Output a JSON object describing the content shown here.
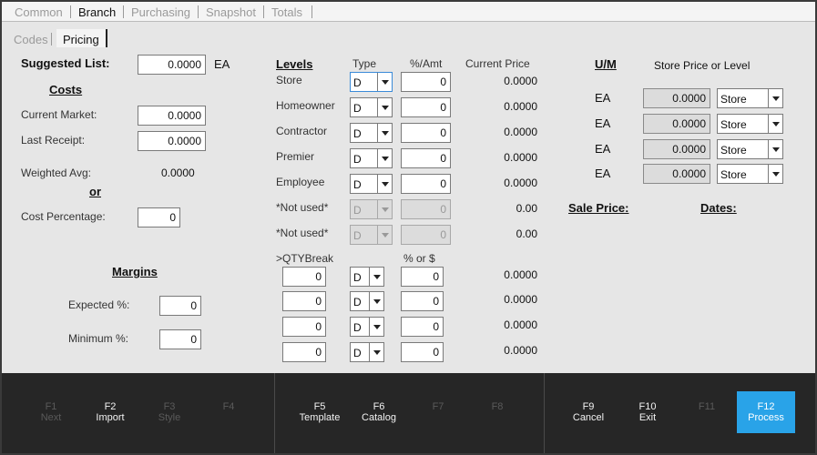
{
  "tabs": [
    "Common",
    "Branch",
    "Purchasing",
    "Snapshot",
    "Totals"
  ],
  "subtabs": [
    "Codes",
    "Pricing"
  ],
  "left": {
    "suggested_list_label": "Suggested List:",
    "suggested_list_value": "0.0000",
    "suggested_list_unit": "EA",
    "costs_label": "Costs",
    "current_market_label": "Current Market:",
    "current_market_value": "0.0000",
    "last_receipt_label": "Last Receipt:",
    "last_receipt_value": "0.0000",
    "weighted_avg_label": "Weighted Avg:",
    "weighted_avg_value": "0.0000",
    "or_label": "or",
    "cost_percentage_label": "Cost Percentage:",
    "cost_percentage_value": "0",
    "margins_label": "Margins",
    "expected_label": "Expected %:",
    "expected_value": "0",
    "minimum_label": "Minimum %:",
    "minimum_value": "0"
  },
  "levels": {
    "header_levels": "Levels",
    "header_type": "Type",
    "header_amt": "%/Amt",
    "header_current": "Current Price",
    "rows": [
      {
        "name": "Store",
        "type": "D",
        "amt": "0",
        "price": "0.0000"
      },
      {
        "name": "Homeowner",
        "type": "D",
        "amt": "0",
        "price": "0.0000"
      },
      {
        "name": "Contractor",
        "type": "D",
        "amt": "0",
        "price": "0.0000"
      },
      {
        "name": "Premier",
        "type": "D",
        "amt": "0",
        "price": "0.0000"
      },
      {
        "name": "Employee",
        "type": "D",
        "amt": "0",
        "price": "0.0000"
      },
      {
        "name": "*Not used*",
        "type": "D",
        "amt": "0",
        "price": "0.00"
      },
      {
        "name": "*Not used*",
        "type": "D",
        "amt": "0",
        "price": "0.00"
      }
    ],
    "qty_break_label": ">QTYBreak",
    "pct_or_dollar_label": "% or $",
    "qty_rows": [
      {
        "qty": "0",
        "type": "D",
        "amt": "0",
        "price": "0.0000"
      },
      {
        "qty": "0",
        "type": "D",
        "amt": "0",
        "price": "0.0000"
      },
      {
        "qty": "0",
        "type": "D",
        "amt": "0",
        "price": "0.0000"
      },
      {
        "qty": "0",
        "type": "D",
        "amt": "0",
        "price": "0.0000"
      }
    ]
  },
  "um": {
    "header_um": "U/M",
    "header_store": "Store Price or Level",
    "rows": [
      {
        "unit": "EA",
        "price": "0.0000",
        "level": "Store"
      },
      {
        "unit": "EA",
        "price": "0.0000",
        "level": "Store"
      },
      {
        "unit": "EA",
        "price": "0.0000",
        "level": "Store"
      },
      {
        "unit": "EA",
        "price": "0.0000",
        "level": "Store"
      }
    ],
    "sale_price_label": "Sale Price:",
    "dates_label": "Dates:"
  },
  "fkeys": [
    {
      "key": "F1",
      "label": "Next"
    },
    {
      "key": "F2",
      "label": "Import"
    },
    {
      "key": "F3",
      "label": "Style"
    },
    {
      "key": "F4",
      "label": ""
    },
    {
      "key": "F5",
      "label": "Template"
    },
    {
      "key": "F6",
      "label": "Catalog"
    },
    {
      "key": "F7",
      "label": ""
    },
    {
      "key": "F8",
      "label": ""
    },
    {
      "key": "F9",
      "label": "Cancel"
    },
    {
      "key": "F10",
      "label": "Exit"
    },
    {
      "key": "F11",
      "label": ""
    },
    {
      "key": "F12",
      "label": "Process"
    }
  ],
  "colors": {
    "accent": "#29a3e8",
    "footer": "#262626"
  }
}
